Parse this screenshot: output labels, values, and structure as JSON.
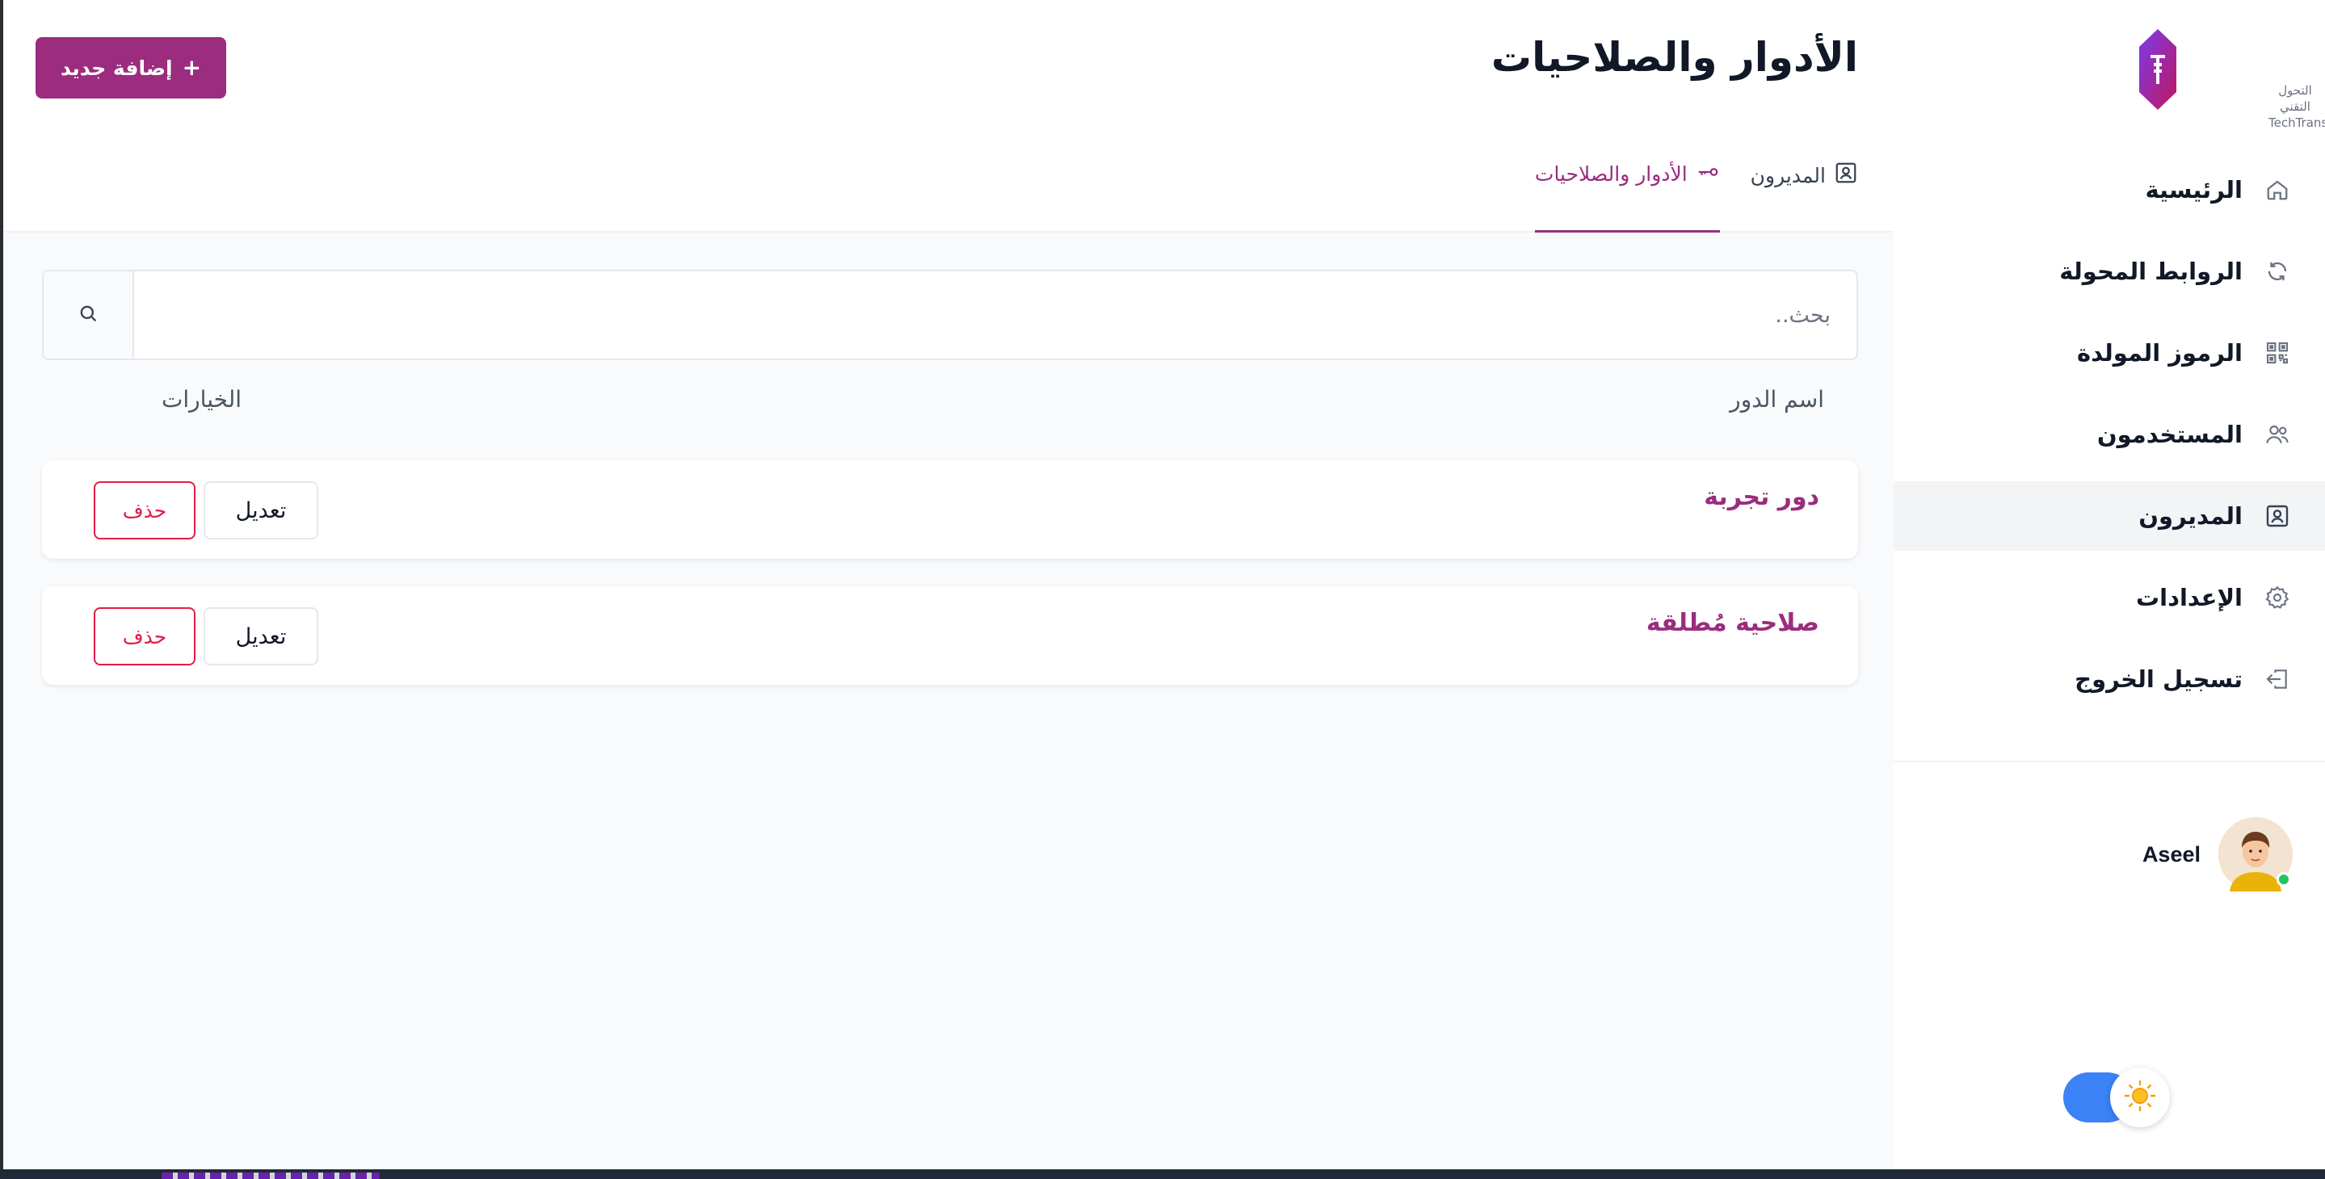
{
  "brand": {
    "logo_text_ar": "التحول التقني",
    "logo_text_en": "TechTrans"
  },
  "page": {
    "title": "الأدوار والصلاحيات"
  },
  "toolbar": {
    "add_label": "إضافة جديد",
    "add_icon": "+"
  },
  "tabs": [
    {
      "label": "المديرون",
      "icon": "user-square-icon",
      "active": false
    },
    {
      "label": "الأدوار والصلاحيات",
      "icon": "key-icon",
      "active": true
    }
  ],
  "search": {
    "placeholder": "بحث..",
    "value": ""
  },
  "table": {
    "columns": {
      "name": "اسم الدور",
      "options": "الخيارات"
    },
    "rows": [
      {
        "name": "دور تجربة",
        "edit_label": "تعديل",
        "delete_label": "حذف"
      },
      {
        "name": "صلاحية مُطلقة",
        "edit_label": "تعديل",
        "delete_label": "حذف"
      }
    ]
  },
  "sidebar": {
    "items": [
      {
        "label": "الرئيسية",
        "icon": "home-icon",
        "active": false
      },
      {
        "label": "الروابط المحولة",
        "icon": "refresh-icon",
        "active": false
      },
      {
        "label": "الرموز المولدة",
        "icon": "qr-code-icon",
        "active": false
      },
      {
        "label": "المستخدمون",
        "icon": "users-icon",
        "active": false
      },
      {
        "label": "المديرون",
        "icon": "user-square-icon",
        "active": true
      },
      {
        "label": "الإعدادات",
        "icon": "gear-icon",
        "active": false
      },
      {
        "label": "تسجيل الخروج",
        "icon": "logout-icon",
        "active": false
      }
    ]
  },
  "user": {
    "name": "Aseel",
    "status": "online"
  },
  "theme": {
    "mode": "light",
    "toggle_icon": "sun-icon"
  },
  "colors": {
    "accent": "#9b2c7e",
    "danger": "#e11d48",
    "toggle": "#3b82f6"
  }
}
